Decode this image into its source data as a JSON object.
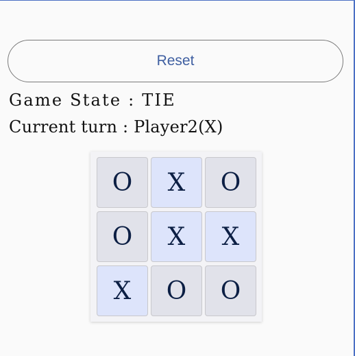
{
  "controls": {
    "reset_label": "Reset"
  },
  "status": {
    "game_state": "Game State : TIE",
    "current_turn": "Current turn : Player2(X)"
  },
  "board": {
    "cells": [
      "O",
      "X",
      "O",
      "O",
      "X",
      "X",
      "X",
      "O",
      "O"
    ]
  },
  "colors": {
    "accent": "#3f5fa1",
    "o_cell": "#e1e2ea",
    "x_cell": "#dde4fb",
    "mark": "#0c1f44"
  }
}
